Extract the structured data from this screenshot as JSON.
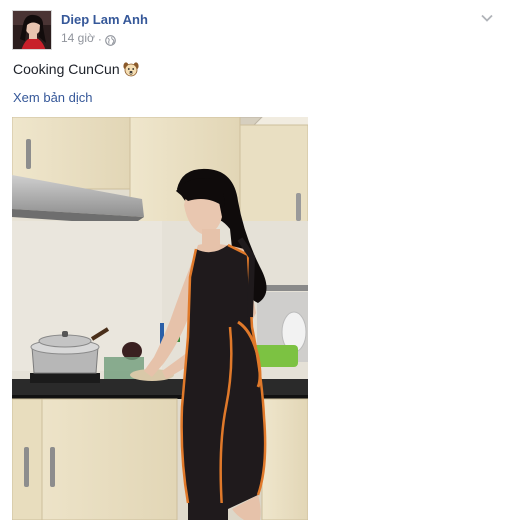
{
  "post": {
    "author_name": "Diep Lam Anh",
    "timestamp": "14 giờ",
    "separator": "·",
    "privacy_icon": "globe-icon",
    "options_icon": "chevron-down-icon",
    "message": "Cooking CunCun",
    "message_emoji": "dog-face-emoji",
    "translate_link": "Xem bản dịch",
    "photo_description_icon": "kitchen-photo"
  },
  "colors": {
    "link_blue": "#365899",
    "meta_gray": "#90949c",
    "text": "#1d2129"
  }
}
